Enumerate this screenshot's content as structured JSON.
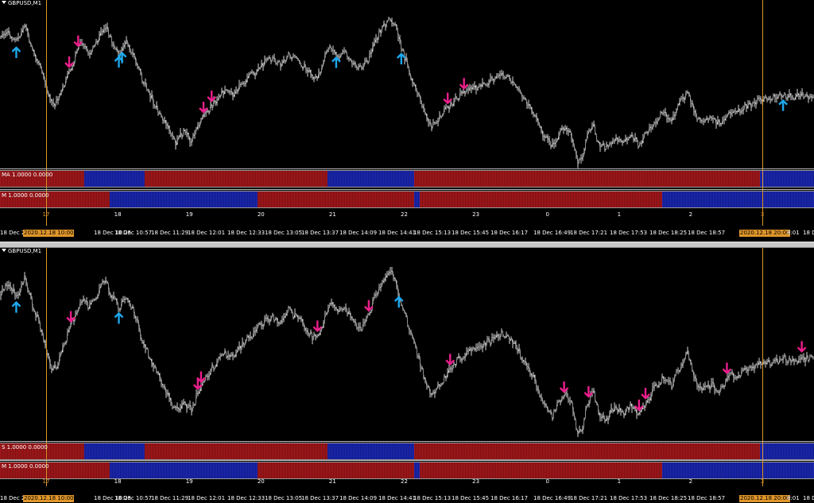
{
  "windows": [
    {
      "title": "GBPUSD,M1",
      "indicators": [
        {
          "label": "MA 1.0000 0.0000",
          "segments": [
            {
              "color": "red",
              "from": 0,
              "to": 0.104
            },
            {
              "color": "blue",
              "from": 0.104,
              "to": 0.178
            },
            {
              "color": "red",
              "from": 0.178,
              "to": 0.402
            },
            {
              "color": "blue",
              "from": 0.402,
              "to": 0.509
            },
            {
              "color": "red",
              "from": 0.509,
              "to": 0.934
            },
            {
              "color": "blue",
              "from": 0.934,
              "to": 1
            }
          ]
        },
        {
          "label": "M 1.0000 0.0000",
          "segments": [
            {
              "color": "red",
              "from": 0,
              "to": 0.135
            },
            {
              "color": "blue",
              "from": 0.135,
              "to": 0.316
            },
            {
              "color": "red",
              "from": 0.316,
              "to": 0.509
            },
            {
              "color": "blue",
              "from": 0.509,
              "to": 0.516
            },
            {
              "color": "red",
              "from": 0.516,
              "to": 0.813
            },
            {
              "color": "blue",
              "from": 0.813,
              "to": 1
            }
          ]
        }
      ],
      "signals": {
        "buy_positions": [
          0.02,
          0.146,
          0.15,
          0.413,
          0.493,
          0.962
        ],
        "sell_positions": [
          0.085,
          0.096,
          0.25,
          0.26,
          0.55,
          0.57
        ]
      }
    },
    {
      "title": "GBPUSD,M1",
      "indicators": [
        {
          "label": "S 1.0000 0.0000",
          "segments": [
            {
              "color": "red",
              "from": 0,
              "to": 0.104
            },
            {
              "color": "blue",
              "from": 0.104,
              "to": 0.178
            },
            {
              "color": "red",
              "from": 0.178,
              "to": 0.402
            },
            {
              "color": "blue",
              "from": 0.402,
              "to": 0.509
            },
            {
              "color": "red",
              "from": 0.509,
              "to": 0.934
            },
            {
              "color": "blue",
              "from": 0.934,
              "to": 1
            }
          ]
        },
        {
          "label": "M 1.0000 0.0000",
          "segments": [
            {
              "color": "red",
              "from": 0,
              "to": 0.135
            },
            {
              "color": "blue",
              "from": 0.135,
              "to": 0.316
            },
            {
              "color": "red",
              "from": 0.316,
              "to": 0.509
            },
            {
              "color": "blue",
              "from": 0.509,
              "to": 0.516
            },
            {
              "color": "red",
              "from": 0.516,
              "to": 0.813
            },
            {
              "color": "blue",
              "from": 0.813,
              "to": 1
            }
          ]
        }
      ],
      "signals": {
        "buy_positions": [
          0.02,
          0.146,
          0.49
        ],
        "sell_positions": [
          0.087,
          0.243,
          0.247,
          0.39,
          0.453,
          0.553,
          0.693,
          0.723,
          0.785,
          0.793,
          0.893,
          0.985
        ]
      }
    }
  ],
  "day_axis": {
    "labels": [
      "17",
      "18",
      "19",
      "20",
      "21",
      "22",
      "23",
      "0",
      "1",
      "2",
      "3"
    ],
    "highlighted": [
      "17",
      "3"
    ]
  },
  "time_axis": {
    "labels": [
      "18 Dec 2",
      "2020.12.18 10:00",
      "18 Dec 10:25",
      "18 Dec 10:57",
      "18 Dec 11:29",
      "18 Dec 12:01",
      "18 Dec 12:33",
      "18 Dec 13:05",
      "18 Dec 13:37",
      "18 Dec 14:09",
      "18 Dec 14:41",
      "18 Dec 15:13",
      "18 Dec 15:45",
      "18 Dec 16:17",
      "18 Dec 16:49",
      "18 Dec 17:21",
      "18 Dec 17:53",
      "18 Dec 18:25",
      "18 Dec 18:57",
      "2020.12.18 20:00",
      "8:01",
      "18 D"
    ],
    "highlighted": [
      "2020.12.18 10:00",
      "2020.12.18 20:00"
    ]
  },
  "price_path": [
    [
      0.0,
      0.2
    ],
    [
      0.01,
      0.14
    ],
    [
      0.02,
      0.22
    ],
    [
      0.03,
      0.11
    ],
    [
      0.04,
      0.26
    ],
    [
      0.05,
      0.38
    ],
    [
      0.058,
      0.52
    ],
    [
      0.065,
      0.62
    ],
    [
      0.072,
      0.58
    ],
    [
      0.08,
      0.46
    ],
    [
      0.09,
      0.34
    ],
    [
      0.1,
      0.22
    ],
    [
      0.11,
      0.28
    ],
    [
      0.12,
      0.2
    ],
    [
      0.13,
      0.12
    ],
    [
      0.138,
      0.22
    ],
    [
      0.146,
      0.28
    ],
    [
      0.155,
      0.22
    ],
    [
      0.165,
      0.3
    ],
    [
      0.175,
      0.46
    ],
    [
      0.185,
      0.55
    ],
    [
      0.195,
      0.66
    ],
    [
      0.205,
      0.75
    ],
    [
      0.215,
      0.85
    ],
    [
      0.225,
      0.78
    ],
    [
      0.235,
      0.84
    ],
    [
      0.245,
      0.72
    ],
    [
      0.255,
      0.65
    ],
    [
      0.265,
      0.58
    ],
    [
      0.275,
      0.52
    ],
    [
      0.285,
      0.54
    ],
    [
      0.295,
      0.5
    ],
    [
      0.305,
      0.44
    ],
    [
      0.315,
      0.4
    ],
    [
      0.325,
      0.35
    ],
    [
      0.335,
      0.32
    ],
    [
      0.345,
      0.35
    ],
    [
      0.355,
      0.29
    ],
    [
      0.365,
      0.33
    ],
    [
      0.375,
      0.38
    ],
    [
      0.385,
      0.44
    ],
    [
      0.393,
      0.42
    ],
    [
      0.4,
      0.3
    ],
    [
      0.408,
      0.24
    ],
    [
      0.415,
      0.3
    ],
    [
      0.425,
      0.28
    ],
    [
      0.435,
      0.36
    ],
    [
      0.445,
      0.38
    ],
    [
      0.455,
      0.3
    ],
    [
      0.462,
      0.2
    ],
    [
      0.47,
      0.12
    ],
    [
      0.478,
      0.08
    ],
    [
      0.486,
      0.1
    ],
    [
      0.493,
      0.26
    ],
    [
      0.5,
      0.34
    ],
    [
      0.507,
      0.46
    ],
    [
      0.515,
      0.56
    ],
    [
      0.522,
      0.67
    ],
    [
      0.53,
      0.75
    ],
    [
      0.538,
      0.71
    ],
    [
      0.548,
      0.64
    ],
    [
      0.558,
      0.58
    ],
    [
      0.568,
      0.54
    ],
    [
      0.578,
      0.52
    ],
    [
      0.588,
      0.49
    ],
    [
      0.598,
      0.47
    ],
    [
      0.608,
      0.44
    ],
    [
      0.618,
      0.41
    ],
    [
      0.628,
      0.46
    ],
    [
      0.638,
      0.52
    ],
    [
      0.648,
      0.6
    ],
    [
      0.658,
      0.68
    ],
    [
      0.668,
      0.8
    ],
    [
      0.678,
      0.87
    ],
    [
      0.688,
      0.78
    ],
    [
      0.696,
      0.75
    ],
    [
      0.703,
      0.82
    ],
    [
      0.71,
      0.96
    ],
    [
      0.716,
      0.92
    ],
    [
      0.722,
      0.8
    ],
    [
      0.728,
      0.72
    ],
    [
      0.735,
      0.85
    ],
    [
      0.745,
      0.88
    ],
    [
      0.755,
      0.82
    ],
    [
      0.765,
      0.86
    ],
    [
      0.775,
      0.8
    ],
    [
      0.785,
      0.86
    ],
    [
      0.795,
      0.78
    ],
    [
      0.805,
      0.71
    ],
    [
      0.815,
      0.66
    ],
    [
      0.825,
      0.7
    ],
    [
      0.835,
      0.6
    ],
    [
      0.845,
      0.53
    ],
    [
      0.855,
      0.68
    ],
    [
      0.865,
      0.72
    ],
    [
      0.875,
      0.7
    ],
    [
      0.885,
      0.73
    ],
    [
      0.895,
      0.64
    ],
    [
      0.905,
      0.66
    ],
    [
      0.915,
      0.62
    ],
    [
      0.925,
      0.6
    ],
    [
      0.935,
      0.57
    ],
    [
      0.945,
      0.58
    ],
    [
      0.955,
      0.56
    ],
    [
      0.965,
      0.55
    ],
    [
      0.975,
      0.57
    ],
    [
      0.985,
      0.54
    ],
    [
      0.995,
      0.56
    ],
    [
      1.0,
      0.55
    ]
  ]
}
